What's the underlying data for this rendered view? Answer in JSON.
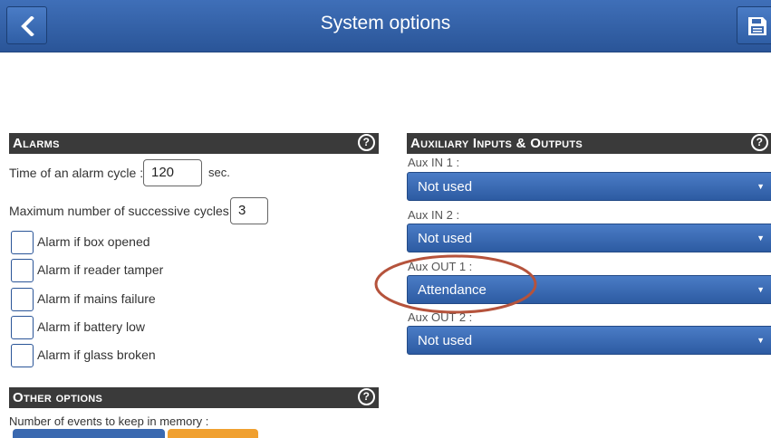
{
  "header": {
    "title": "System options",
    "back_icon": "chevron-left-icon",
    "save_icon": "floppy-disk-icon"
  },
  "alarms": {
    "title": "Alarms",
    "cycle_label": "Time of an alarm cycle :",
    "cycle_value": "120",
    "cycle_unit": "sec.",
    "max_cycles_label": "Maximum number of successive cycles :",
    "max_cycles_value": "3",
    "checkboxes": [
      {
        "label": "Alarm if box opened",
        "checked": false
      },
      {
        "label": "Alarm if reader tamper",
        "checked": false
      },
      {
        "label": "Alarm if mains failure",
        "checked": false
      },
      {
        "label": "Alarm if battery low",
        "checked": false
      },
      {
        "label": "Alarm if glass broken",
        "checked": false
      }
    ]
  },
  "aux": {
    "title": "Auxiliary Inputs & Outputs",
    "fields": [
      {
        "label": "Aux IN 1 :",
        "value": "Not used"
      },
      {
        "label": "Aux IN 2 :",
        "value": "Not used"
      },
      {
        "label": "Aux OUT 1 :",
        "value": "Attendance"
      },
      {
        "label": "Aux OUT 2 :",
        "value": "Not used"
      }
    ]
  },
  "other": {
    "title": "Other options",
    "events_label": "Number of events to keep in memory :"
  },
  "help_glyph": "?",
  "colors": {
    "accent": "#2a5598",
    "section_header": "#3a3a3a",
    "highlight": "#b5533c",
    "orange_button": "#f0a030"
  }
}
